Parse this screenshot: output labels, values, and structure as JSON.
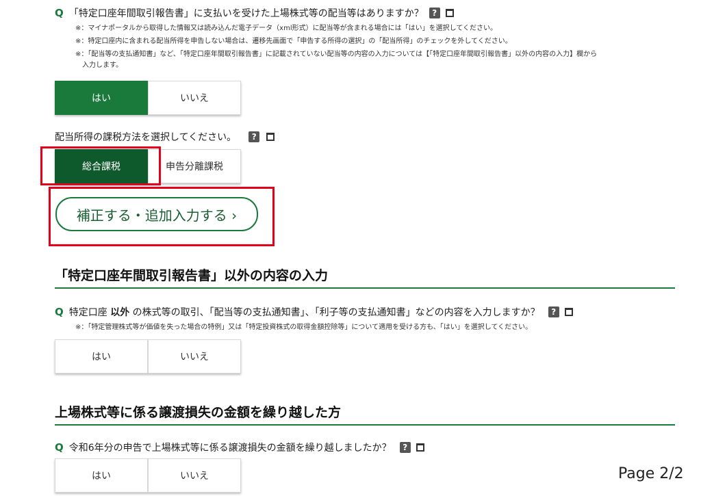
{
  "q1": {
    "mark": "Q",
    "text": "「特定口座年間取引報告書」に支払いを受けた上場株式等の配当等はありますか？",
    "help": "?",
    "notes": [
      "※：マイナポータルから取得した情報又は読み込んだ電子データ（xml形式）に配当等が含まれる場合には「はい」を選択してください。",
      "※：特定口座内に含まれる配当所得を申告しない場合は、遷移先画面で「申告する所得の選択」の「配当所得」のチェックを外してください。",
      "※：「配当等の支払通知書」など、「特定口座年間取引報告書」に記載されていない配当等の内容の入力については【「特定口座年間取引報告書」以外の内容の入力】欄から",
      "入力します。"
    ],
    "yes": "はい",
    "no": "いいえ"
  },
  "q2": {
    "text": "配当所得の課税方法を選択してください。",
    "help": "?",
    "opt1": "総合課税",
    "opt2": "申告分離課税"
  },
  "correct_button": "補正する・追加入力する ›",
  "section2": {
    "heading": "「特定口座年間取引報告書」以外の内容の入力",
    "mark": "Q",
    "q_prefix": "特定口座 ",
    "q_bold": "以外",
    "q_suffix": " の株式等の取引、「配当等の支払通知書」、「利子等の支払通知書」などの内容を入力しますか？",
    "help": "?",
    "note": "※：「特定管理株式等が価値を失った場合の特例」又は「特定投資株式の取得金額控除等」について適用を受ける方も、「はい」を選択してください。",
    "yes": "はい",
    "no": "いいえ"
  },
  "section3": {
    "heading": "上場株式等に係る譲渡損失の金額を繰り越した方",
    "mark": "Q",
    "question": "令和6年分の申告で上場株式等に係る譲渡損失の金額を繰り越しましたか？",
    "help": "?",
    "yes": "はい",
    "no": "いいえ"
  },
  "page_indicator": "Page 2/2",
  "colors": {
    "accent": "#1a7a3c",
    "highlight": "#e2001a"
  }
}
